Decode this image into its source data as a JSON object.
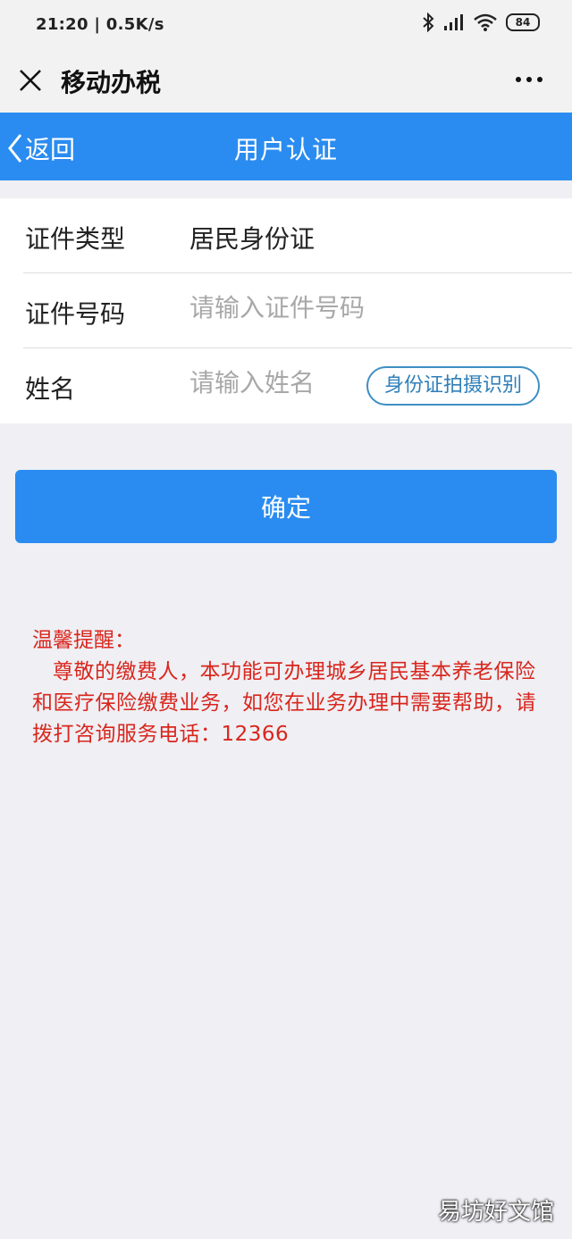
{
  "status_bar": {
    "time": "21:20 | 0.5K/s",
    "battery": "84",
    "icons": [
      "bluetooth-icon",
      "signal-icon",
      "wifi-icon",
      "battery-icon"
    ]
  },
  "title_bar": {
    "title": "移动办税",
    "close_icon": "close-icon",
    "more_icon": "more-icon"
  },
  "nav_bar": {
    "back_label": "返回",
    "title": "用户认证",
    "color": "#2a8cf0"
  },
  "form": {
    "id_type": {
      "label": "证件类型",
      "value": "居民身份证"
    },
    "id_number": {
      "label": "证件号码",
      "placeholder": "请输入证件号码"
    },
    "name": {
      "label": "姓名",
      "placeholder": "请输入姓名"
    },
    "scan_button": "身份证拍摄识别"
  },
  "confirm_button": "确定",
  "notice": {
    "title": "温馨提醒：",
    "body": "尊敬的缴费人，本功能可办理城乡居民基本养老保险和医疗保险缴费业务，如您在业务办理中需要帮助，请拨打咨询服务电话：12366",
    "color": "#d9261c"
  },
  "watermark": "易坊好文馆"
}
